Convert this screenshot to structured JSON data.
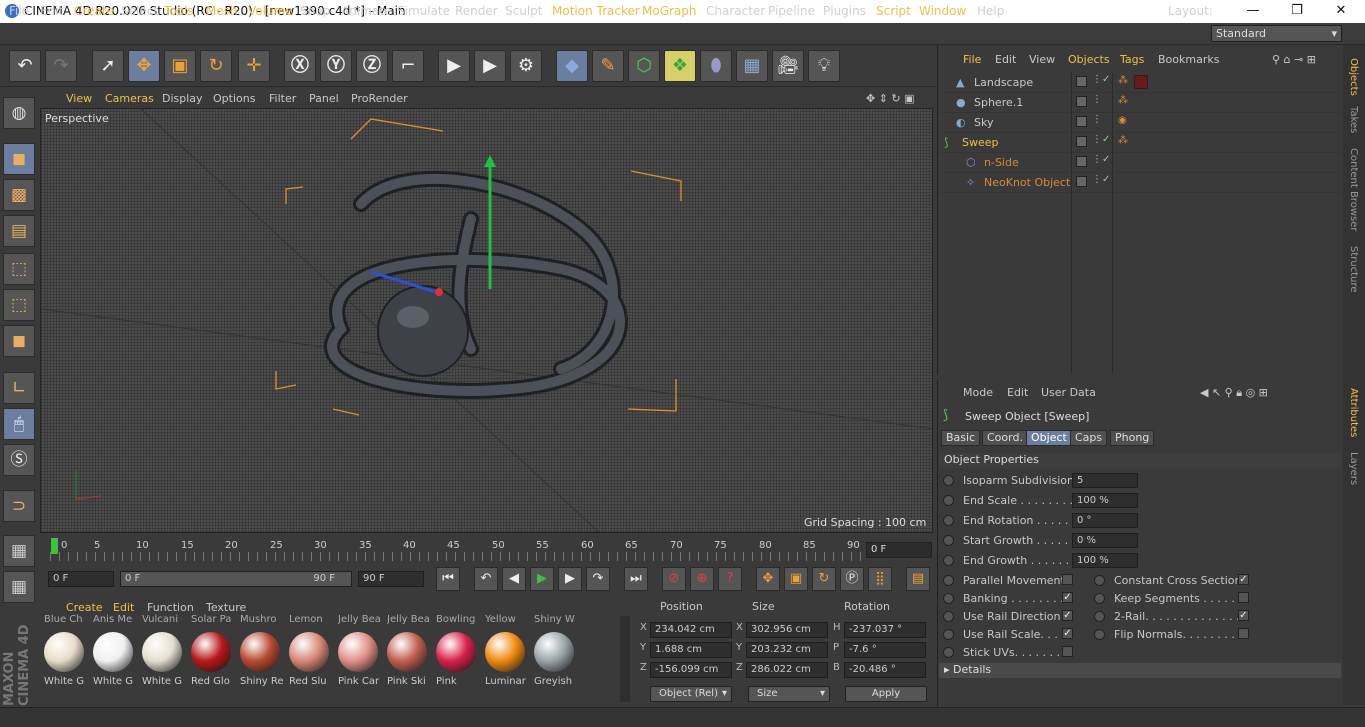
{
  "titlebar": {
    "title": "CINEMA 4D R20.026 Studio (RC - R20) - [new1390.c4d *] - Main",
    "min": "—",
    "max": "❐",
    "close": "✕"
  },
  "menus": [
    "File",
    "Edit",
    "Create",
    "Select",
    "Tools",
    "Mesh",
    "Volume",
    "Snap",
    "Animate",
    "Simulate",
    "Render",
    "Sculpt",
    "Motion Tracker",
    "MoGraph",
    "Character",
    "Pipeline",
    "Plugins",
    "Script",
    "Window",
    "Help"
  ],
  "layout": {
    "label": "Layout:",
    "value": "Standard"
  },
  "viewport": {
    "menu": [
      "View",
      "Cameras",
      "Display",
      "Options",
      "Filter",
      "Panel",
      "ProRender"
    ],
    "label": "Perspective",
    "grid": "Grid Spacing : 100 cm"
  },
  "timeline": {
    "ticks": [
      "0",
      "5",
      "10",
      "15",
      "20",
      "25",
      "30",
      "35",
      "40",
      "45",
      "50",
      "55",
      "60",
      "65",
      "70",
      "75",
      "80",
      "85",
      "90"
    ],
    "frame": "0 F",
    "start": "0 F",
    "range_start": "0 F",
    "range_end": "90 F",
    "end": "90 F"
  },
  "materials": {
    "tabs": [
      "Create",
      "Edit",
      "Function",
      "Texture"
    ],
    "items": [
      {
        "name": "White G",
        "color": "#e8dcc8"
      },
      {
        "name": "White G",
        "color": "#f0f0f0"
      },
      {
        "name": "White G",
        "color": "#e6dfcf"
      },
      {
        "name": "Red Glo",
        "color": "#b81818"
      },
      {
        "name": "Shiny Re",
        "color": "#b84a30"
      },
      {
        "name": "Red Slu",
        "color": "#d88878"
      },
      {
        "name": "Pink Car",
        "color": "#e09088"
      },
      {
        "name": "Pink Ski",
        "color": "#c06050"
      },
      {
        "name": "Pink",
        "color": "#d8204a"
      },
      {
        "name": "Luminar",
        "color": "#f08a10"
      },
      {
        "name": "Greyish",
        "color": "#9aa4a8"
      }
    ],
    "top_labels": [
      "Blue Ch",
      "Anis Me",
      "Vulcani",
      "Solar Pa",
      "Mushro",
      "Lemon",
      "Jelly Bea",
      "Jelly Bea",
      "Bowling",
      "Yellow",
      "Shiny W"
    ]
  },
  "coords": {
    "headers": [
      "Position",
      "Size",
      "Rotation"
    ],
    "rows": [
      {
        "axis": "X",
        "pos": "234.042 cm",
        "size_axis": "X",
        "size": "302.956 cm",
        "rot_axis": "H",
        "rot": "-237.037 °"
      },
      {
        "axis": "Y",
        "pos": "1.688 cm",
        "size_axis": "Y",
        "size": "203.232 cm",
        "rot_axis": "P",
        "rot": "-7.6 °"
      },
      {
        "axis": "Z",
        "pos": "-156.099 cm",
        "size_axis": "Z",
        "size": "286.022 cm",
        "rot_axis": "B",
        "rot": "-20.486 °"
      }
    ],
    "mode": "Object (Rel)",
    "sizemode": "Size",
    "apply": "Apply"
  },
  "objects": {
    "menu": [
      "File",
      "Edit",
      "View",
      "Objects",
      "Tags",
      "Bookmarks"
    ],
    "items": [
      {
        "name": "Landscape",
        "color": "#c8c8c8"
      },
      {
        "name": "Sphere.1",
        "color": "#c8c8c8"
      },
      {
        "name": "Sky",
        "color": "#c8c8c8"
      },
      {
        "name": "Sweep",
        "color": "#f0c048"
      },
      {
        "name": "n-Side",
        "color": "#d88a30"
      },
      {
        "name": "NeoKnot Object",
        "color": "#d88a30"
      }
    ]
  },
  "side_tabs_top": [
    "Objects",
    "Takes",
    "Content Browser",
    "Structure"
  ],
  "side_tabs_bottom": [
    "Attributes",
    "Layers"
  ],
  "attributes": {
    "menu": [
      "Mode",
      "Edit",
      "User Data"
    ],
    "title": "Sweep Object [Sweep]",
    "tabs": [
      "Basic",
      "Coord.",
      "Object",
      "Caps",
      "Phong"
    ],
    "section": "Object Properties",
    "props": [
      {
        "label": "Isoparm Subdivision",
        "value": "5"
      },
      {
        "label": "End Scale . . . . . . . . . .",
        "value": "100 %"
      },
      {
        "label": "End Rotation . . . . . .",
        "value": "0 °"
      },
      {
        "label": "Start Growth . . . . . .",
        "value": "0 %"
      },
      {
        "label": "End Growth . . . . . . .",
        "value": "100 %"
      }
    ],
    "checks_left": [
      {
        "label": "Parallel Movement",
        "checked": ""
      },
      {
        "label": "Banking . . . . . . . . .",
        "checked": "✓"
      },
      {
        "label": "Use Rail Direction",
        "checked": "✓"
      },
      {
        "label": "Use Rail Scale. . . .",
        "checked": "✓"
      },
      {
        "label": "Stick UVs. . . . . . . .",
        "checked": ""
      }
    ],
    "checks_right": [
      {
        "label": "Constant Cross Section",
        "checked": "✓"
      },
      {
        "label": "Keep Segments . . . . . .",
        "checked": ""
      },
      {
        "label": "2-Rail. . . . . . . . . . . . . . .",
        "checked": "✓"
      },
      {
        "label": "Flip Normals. . . . . . . . .",
        "checked": ""
      }
    ],
    "details": "Details"
  }
}
